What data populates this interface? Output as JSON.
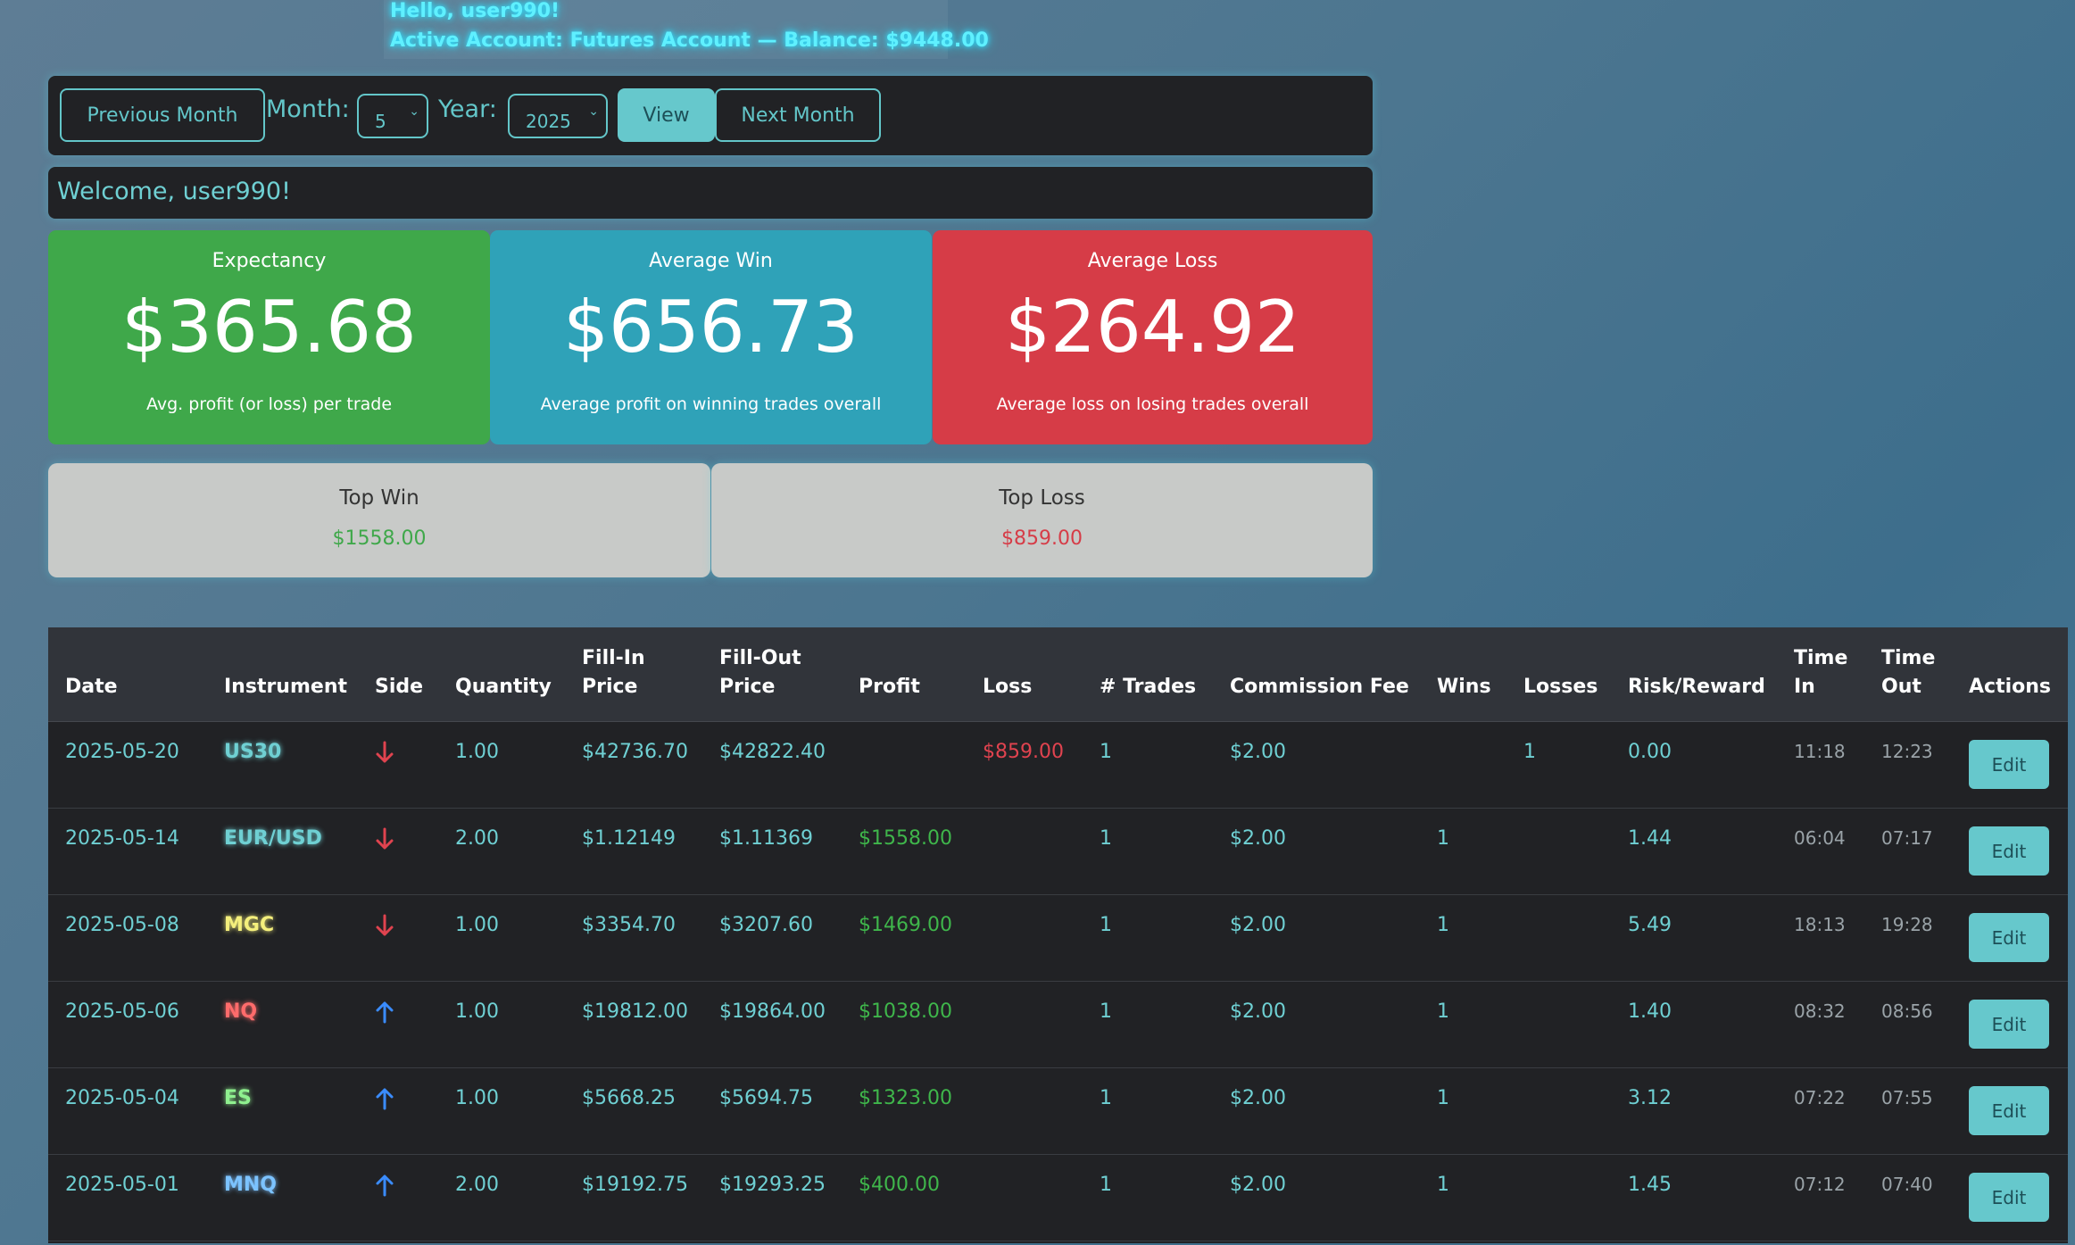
{
  "header": {
    "hello": "Hello, user990!",
    "account_line": "Active Account: Futures Account — Balance: $9448.00"
  },
  "nav": {
    "prev_label": "Previous Month",
    "month_label": "Month:",
    "month_value": "5",
    "year_label": "Year:",
    "year_value": "2025",
    "view_label": "View",
    "next_label": "Next Month"
  },
  "welcome": "Welcome, user990!",
  "stats": {
    "expectancy": {
      "title": "Expectancy",
      "value": "$365.68",
      "sub": "Avg. profit (or loss) per trade"
    },
    "avg_win": {
      "title": "Average Win",
      "value": "$656.73",
      "sub": "Average profit on winning trades overall"
    },
    "avg_loss": {
      "title": "Average Loss",
      "value": "$264.92",
      "sub": "Average loss on losing trades overall"
    }
  },
  "top": {
    "win_title": "Top Win",
    "win_value": "$1558.00",
    "loss_title": "Top Loss",
    "loss_value": "$859.00"
  },
  "colors": {
    "win": "#3fa84a",
    "avg": "#2fa2b8",
    "loss": "#d63c47",
    "accent": "#63c6c9"
  },
  "table": {
    "headers": {
      "date": "Date",
      "instrument": "Instrument",
      "side": "Side",
      "quantity": "Quantity",
      "fill_in_1": "Fill-In",
      "fill_in_2": "Price",
      "fill_out_1": "Fill-Out",
      "fill_out_2": "Price",
      "profit": "Profit",
      "loss": "Loss",
      "trades": "# Trades",
      "commission": "Commission Fee",
      "wins": "Wins",
      "losses": "Losses",
      "rr": "Risk/Reward",
      "time_in_1": "Time",
      "time_in_2": "In",
      "time_out_1": "Time",
      "time_out_2": "Out",
      "actions": "Actions"
    },
    "edit_label": "Edit",
    "rows": [
      {
        "date": "2025-05-20",
        "instrument": "US30",
        "inst_color": "#6fd0d3",
        "side": "down",
        "quantity": "1.00",
        "fill_in": "$42736.70",
        "fill_out": "$42822.40",
        "profit": "",
        "loss": "$859.00",
        "trades": "1",
        "commission": "$2.00",
        "wins": "",
        "losses": "1",
        "rr": "0.00",
        "time_in": "11:18",
        "time_out": "12:23"
      },
      {
        "date": "2025-05-14",
        "instrument": "EUR/USD",
        "inst_color": "#6fd0d3",
        "side": "down",
        "quantity": "2.00",
        "fill_in": "$1.12149",
        "fill_out": "$1.11369",
        "profit": "$1558.00",
        "loss": "",
        "trades": "1",
        "commission": "$2.00",
        "wins": "1",
        "losses": "",
        "rr": "1.44",
        "time_in": "06:04",
        "time_out": "07:17"
      },
      {
        "date": "2025-05-08",
        "instrument": "MGC",
        "inst_color": "#f4ef7c",
        "side": "down",
        "quantity": "1.00",
        "fill_in": "$3354.70",
        "fill_out": "$3207.60",
        "profit": "$1469.00",
        "loss": "",
        "trades": "1",
        "commission": "$2.00",
        "wins": "1",
        "losses": "",
        "rr": "5.49",
        "time_in": "18:13",
        "time_out": "19:28"
      },
      {
        "date": "2025-05-06",
        "instrument": "NQ",
        "inst_color": "#ff6b6b",
        "side": "up",
        "quantity": "1.00",
        "fill_in": "$19812.00",
        "fill_out": "$19864.00",
        "profit": "$1038.00",
        "loss": "",
        "trades": "1",
        "commission": "$2.00",
        "wins": "1",
        "losses": "",
        "rr": "1.40",
        "time_in": "08:32",
        "time_out": "08:56"
      },
      {
        "date": "2025-05-04",
        "instrument": "ES",
        "inst_color": "#8ff08f",
        "side": "up",
        "quantity": "1.00",
        "fill_in": "$5668.25",
        "fill_out": "$5694.75",
        "profit": "$1323.00",
        "loss": "",
        "trades": "1",
        "commission": "$2.00",
        "wins": "1",
        "losses": "",
        "rr": "3.12",
        "time_in": "07:22",
        "time_out": "07:55"
      },
      {
        "date": "2025-05-01",
        "instrument": "MNQ",
        "inst_color": "#7cc3ff",
        "side": "up",
        "quantity": "2.00",
        "fill_in": "$19192.75",
        "fill_out": "$19293.25",
        "profit": "$400.00",
        "loss": "",
        "trades": "1",
        "commission": "$2.00",
        "wins": "1",
        "losses": "",
        "rr": "1.45",
        "time_in": "07:12",
        "time_out": "07:40"
      }
    ]
  }
}
